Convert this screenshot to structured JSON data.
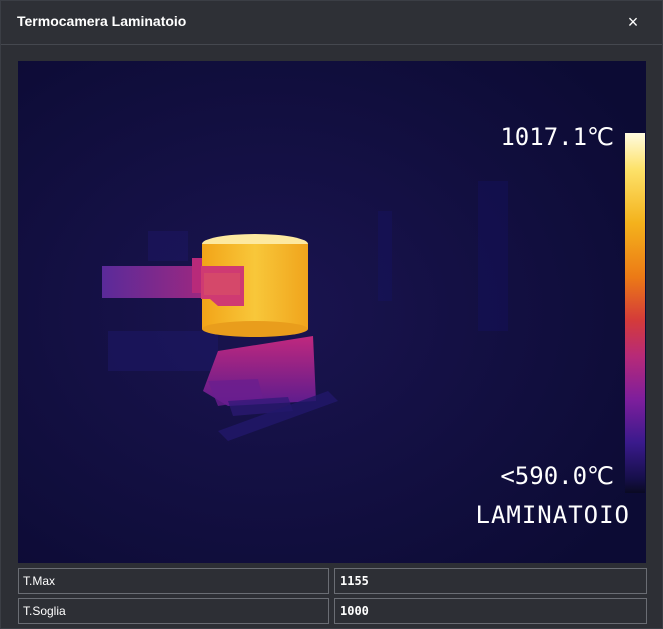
{
  "dialog": {
    "title": "Termocamera Laminatoio",
    "close_symbol": "×"
  },
  "thermal_view": {
    "max_temp": "1017.1℃",
    "min_temp": "<590.0℃",
    "camera_name": "LAMINATOIO",
    "palette": [
      "#fffbe0",
      "#fde26a",
      "#f4b21c",
      "#ec7a16",
      "#d43b3a",
      "#b72a78",
      "#7e1e9c",
      "#3a1a8c",
      "#160f4a",
      "#0a0a22"
    ]
  },
  "readings": [
    {
      "label": "T.Max",
      "value": "1155"
    },
    {
      "label": "T.Soglia",
      "value": "1000"
    }
  ]
}
